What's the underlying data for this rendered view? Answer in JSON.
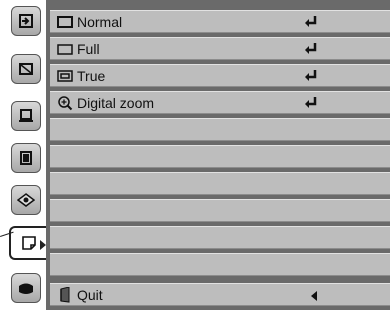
{
  "menu": {
    "items": [
      {
        "label": "Normal",
        "icon": "screen-normal-icon"
      },
      {
        "label": "Full",
        "icon": "screen-full-icon"
      },
      {
        "label": "True",
        "icon": "screen-true-icon"
      },
      {
        "label": "Digital zoom",
        "icon": "magnifier-icon"
      }
    ],
    "quit_label": "Quit"
  },
  "tabs": [
    "input-icon",
    "image-adjust-icon",
    "projector-icon",
    "image-select-icon",
    "color-wheel-icon",
    "screen-icon",
    "setting-icon"
  ],
  "colors": {
    "row": "#bdbdbd",
    "background": "#6a6a6a"
  }
}
